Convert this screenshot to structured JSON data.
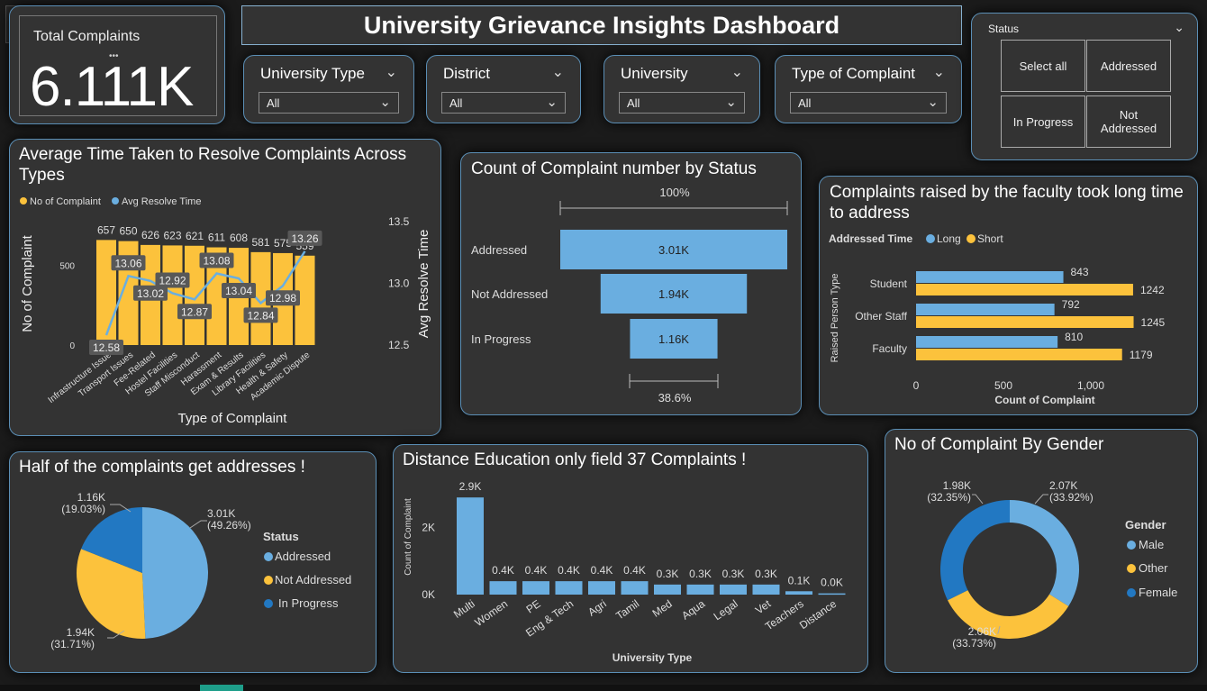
{
  "dashboard": {
    "title": "University Grievance Insights Dashboard"
  },
  "kpi": {
    "label": "Total Complaints",
    "value": "6.111K",
    "more": "•••"
  },
  "back": {
    "icon": "back-arrow-icon"
  },
  "filters": [
    {
      "label": "University Type",
      "value": "All"
    },
    {
      "label": "District",
      "value": "All"
    },
    {
      "label": "University",
      "value": "All"
    },
    {
      "label": "Type of Complaint",
      "value": "All"
    }
  ],
  "status_slicer": {
    "label": "Status",
    "options": [
      "Select all",
      "Addressed",
      "In Progress",
      "Not Addressed"
    ]
  },
  "colors": {
    "blue": "#6aaee0",
    "yellow": "#fcc23c",
    "dark_blue": "#2278c2",
    "panel": "#333333",
    "border": "#5b8fb6"
  },
  "combo": {
    "title": "Average Time Taken to Resolve Complaints Across Types",
    "legend": [
      "No of Complaint",
      "Avg Resolve Time"
    ],
    "ylabel_left": "No of Complaint",
    "ylabel_right": "Avg Resolve Time",
    "xlabel": "Type of Complaint"
  },
  "funnel": {
    "title": "Count of Complaint number by Status",
    "top_pct": "100%",
    "bottom_pct": "38.6%"
  },
  "faculty": {
    "title": "Complaints raised by the faculty took long time to address",
    "legend_title": "Addressed Time",
    "legend": [
      "Long",
      "Short"
    ],
    "ylabel": "Raised Person Type",
    "xlabel": "Count of Complaint"
  },
  "pie": {
    "title": "Half of the complaints get addresses !",
    "legend_title": "Status",
    "legend": [
      "Addressed",
      "Not Addressed",
      "In Progress"
    ]
  },
  "dist": {
    "title": "Distance Education only field 37 Complaints !",
    "ylabel": "Count of Complaint",
    "xlabel": "University Type"
  },
  "gender": {
    "title": "No of Complaint By Gender",
    "legend_title": "Gender",
    "legend": [
      "Male",
      "Other",
      "Female"
    ]
  },
  "chart_data": [
    {
      "id": "combo",
      "type": "bar",
      "categories": [
        "Infrastructure Issue",
        "Transport Issues",
        "Fee-Related",
        "Hostel Facilities",
        "Staff Misconduct",
        "Harassment",
        "Exam & Results",
        "Library Facilities",
        "Health & Safety",
        "Academic Dispute"
      ],
      "series": [
        {
          "name": "No of Complaint",
          "values": [
            657,
            650,
            626,
            623,
            621,
            611,
            608,
            581,
            575,
            559
          ]
        },
        {
          "name": "Avg Resolve Time",
          "values": [
            12.58,
            13.06,
            13.02,
            12.92,
            12.87,
            13.08,
            13.04,
            12.84,
            12.98,
            13.26
          ]
        }
      ],
      "yticks_left": [
        "0",
        "500"
      ],
      "yticks_right": [
        "12.5",
        "13.0",
        "13.5"
      ],
      "ylim_left": [
        0,
        800
      ],
      "ylim_right": [
        12.5,
        13.5
      ]
    },
    {
      "id": "funnel",
      "type": "bar",
      "categories": [
        "Addressed",
        "Not Addressed",
        "In Progress"
      ],
      "values": [
        3010,
        1940,
        1160
      ],
      "labels": [
        "3.01K",
        "1.94K",
        "1.16K"
      ]
    },
    {
      "id": "faculty",
      "type": "bar",
      "categories": [
        "Student",
        "Other Staff",
        "Faculty"
      ],
      "series": [
        {
          "name": "Long",
          "values": [
            843,
            792,
            810
          ]
        },
        {
          "name": "Short",
          "values": [
            1242,
            1245,
            1179
          ]
        }
      ],
      "xticks": [
        "0",
        "500",
        "1,000"
      ],
      "xlim": [
        0,
        1300
      ]
    },
    {
      "id": "pie",
      "type": "pie",
      "categories": [
        "Addressed",
        "Not Addressed",
        "In Progress"
      ],
      "values": [
        49.26,
        31.71,
        19.03
      ],
      "labels": [
        "3.01K",
        "1.94K",
        "1.16K"
      ],
      "pct_labels": [
        "(49.26%)",
        "(31.71%)",
        "(19.03%)"
      ]
    },
    {
      "id": "dist",
      "type": "bar",
      "categories": [
        "Multi",
        "Women",
        "PE",
        "Eng & Tech",
        "Agri",
        "Tamil",
        "Med",
        "Aqua",
        "Legal",
        "Vet",
        "Teachers",
        "Distance"
      ],
      "values": [
        2900,
        400,
        400,
        400,
        400,
        400,
        300,
        300,
        300,
        300,
        100,
        37
      ],
      "labels": [
        "2.9K",
        "0.4K",
        "0.4K",
        "0.4K",
        "0.4K",
        "0.4K",
        "0.3K",
        "0.3K",
        "0.3K",
        "0.3K",
        "0.1K",
        "0.0K"
      ],
      "yticks": [
        "0K",
        "2K"
      ],
      "ylim": [
        0,
        3200
      ]
    },
    {
      "id": "gender",
      "type": "pie",
      "categories": [
        "Male",
        "Other",
        "Female"
      ],
      "values": [
        33.92,
        33.73,
        32.35
      ],
      "labels": [
        "2.07K",
        "2.06K",
        "1.98K"
      ],
      "pct_labels": [
        "(33.92%)",
        "(33.73%)",
        "(32.35%)"
      ]
    }
  ]
}
